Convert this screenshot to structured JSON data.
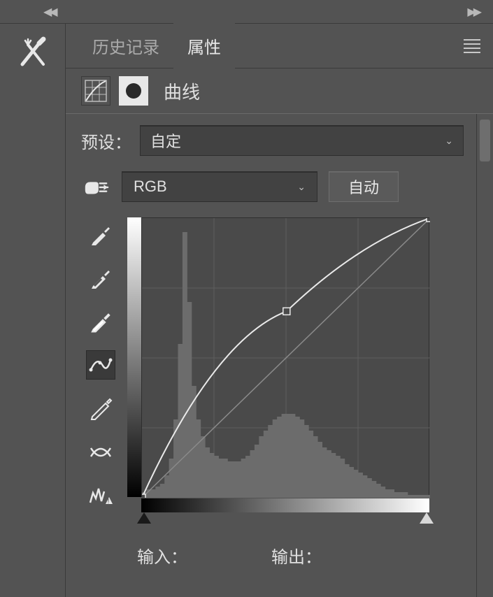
{
  "tabs": {
    "history": "历史记录",
    "properties": "属性"
  },
  "panel": {
    "title": "曲线",
    "preset_label": "预设：",
    "preset_value": "自定",
    "channel_value": "RGB",
    "auto_button": "自动",
    "input_label": "输入：",
    "output_label": "输出："
  },
  "chart_data": {
    "type": "line",
    "title": "曲线",
    "xlabel": "输入",
    "ylabel": "输出",
    "xlim": [
      0,
      255
    ],
    "ylim": [
      0,
      255
    ],
    "series": [
      {
        "name": "baseline",
        "x": [
          0,
          255
        ],
        "y": [
          0,
          255
        ]
      },
      {
        "name": "curve",
        "x": [
          0,
          128,
          255
        ],
        "y": [
          0,
          170,
          255
        ]
      }
    ],
    "control_points": [
      {
        "x": 0,
        "y": 0
      },
      {
        "x": 128,
        "y": 170
      },
      {
        "x": 255,
        "y": 255
      }
    ],
    "histogram": {
      "bins": 64,
      "range": [
        0,
        255
      ],
      "values": [
        2,
        3,
        3,
        4,
        5,
        8,
        14,
        28,
        55,
        95,
        70,
        40,
        28,
        22,
        18,
        16,
        15,
        14,
        14,
        13,
        13,
        13,
        14,
        15,
        17,
        19,
        22,
        24,
        26,
        28,
        29,
        30,
        30,
        30,
        29,
        28,
        26,
        24,
        22,
        20,
        18,
        17,
        16,
        15,
        14,
        12,
        11,
        10,
        9,
        8,
        7,
        6,
        5,
        4,
        3,
        3,
        2,
        2,
        2,
        1,
        1,
        1,
        1,
        1
      ]
    },
    "slider_black": 0,
    "slider_white": 255
  }
}
